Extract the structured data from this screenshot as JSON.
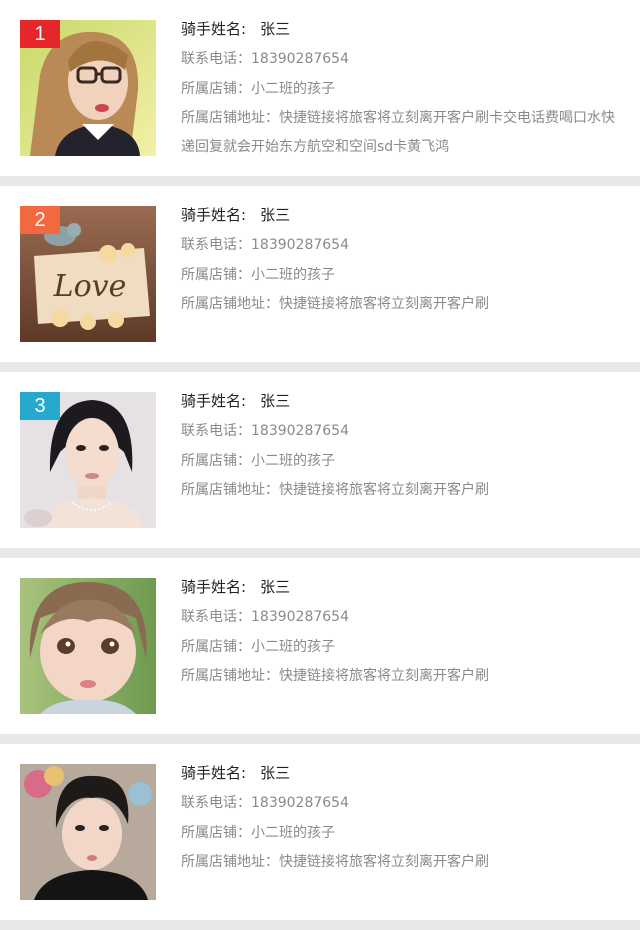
{
  "riders": [
    {
      "rank": "1",
      "rank_color": "#e5262a",
      "name_label": "骑手姓名:",
      "name": "张三",
      "phone": "联系电话：18390287654",
      "shop": "所属店铺：小二班的孩子",
      "address": "所属店铺地址：快捷链接将旅客将立刻离开客户刷卡交电话费喝口水快递回复就会开始东方航空和空间sd卡黄飞鸿",
      "photo": "woman-glasses-photo"
    },
    {
      "rank": "2",
      "rank_color": "#f2693f",
      "name_label": "骑手姓名:",
      "name": "张三",
      "phone": "联系电话：18390287654",
      "shop": "所属店铺：小二班的孩子",
      "address": "所属店铺地址：快捷链接将旅客将立刻离开客户刷",
      "photo": "love-sign-photo",
      "photo_text": "Love"
    },
    {
      "rank": "3",
      "rank_color": "#26a9cf",
      "name_label": "骑手姓名:",
      "name": "张三",
      "phone": "联系电话：18390287654",
      "shop": "所属店铺：小二班的孩子",
      "address": "所属店铺地址：快捷链接将旅客将立刻离开客户刷",
      "photo": "woman-portrait-photo"
    },
    {
      "rank": "",
      "rank_color": "",
      "name_label": "骑手姓名:",
      "name": "张三",
      "phone": "联系电话：18390287654",
      "shop": "所属店铺：小二班的孩子",
      "address": "所属店铺地址：快捷链接将旅客将立刻离开客户刷",
      "photo": "child-portrait-photo"
    },
    {
      "rank": "",
      "rank_color": "",
      "name_label": "骑手姓名:",
      "name": "张三",
      "phone": "联系电话：18390287654",
      "shop": "所属店铺：小二班的孩子",
      "address": "所属店铺地址：快捷链接将旅客将立刻离开客户刷",
      "photo": "young-man-photo"
    }
  ]
}
